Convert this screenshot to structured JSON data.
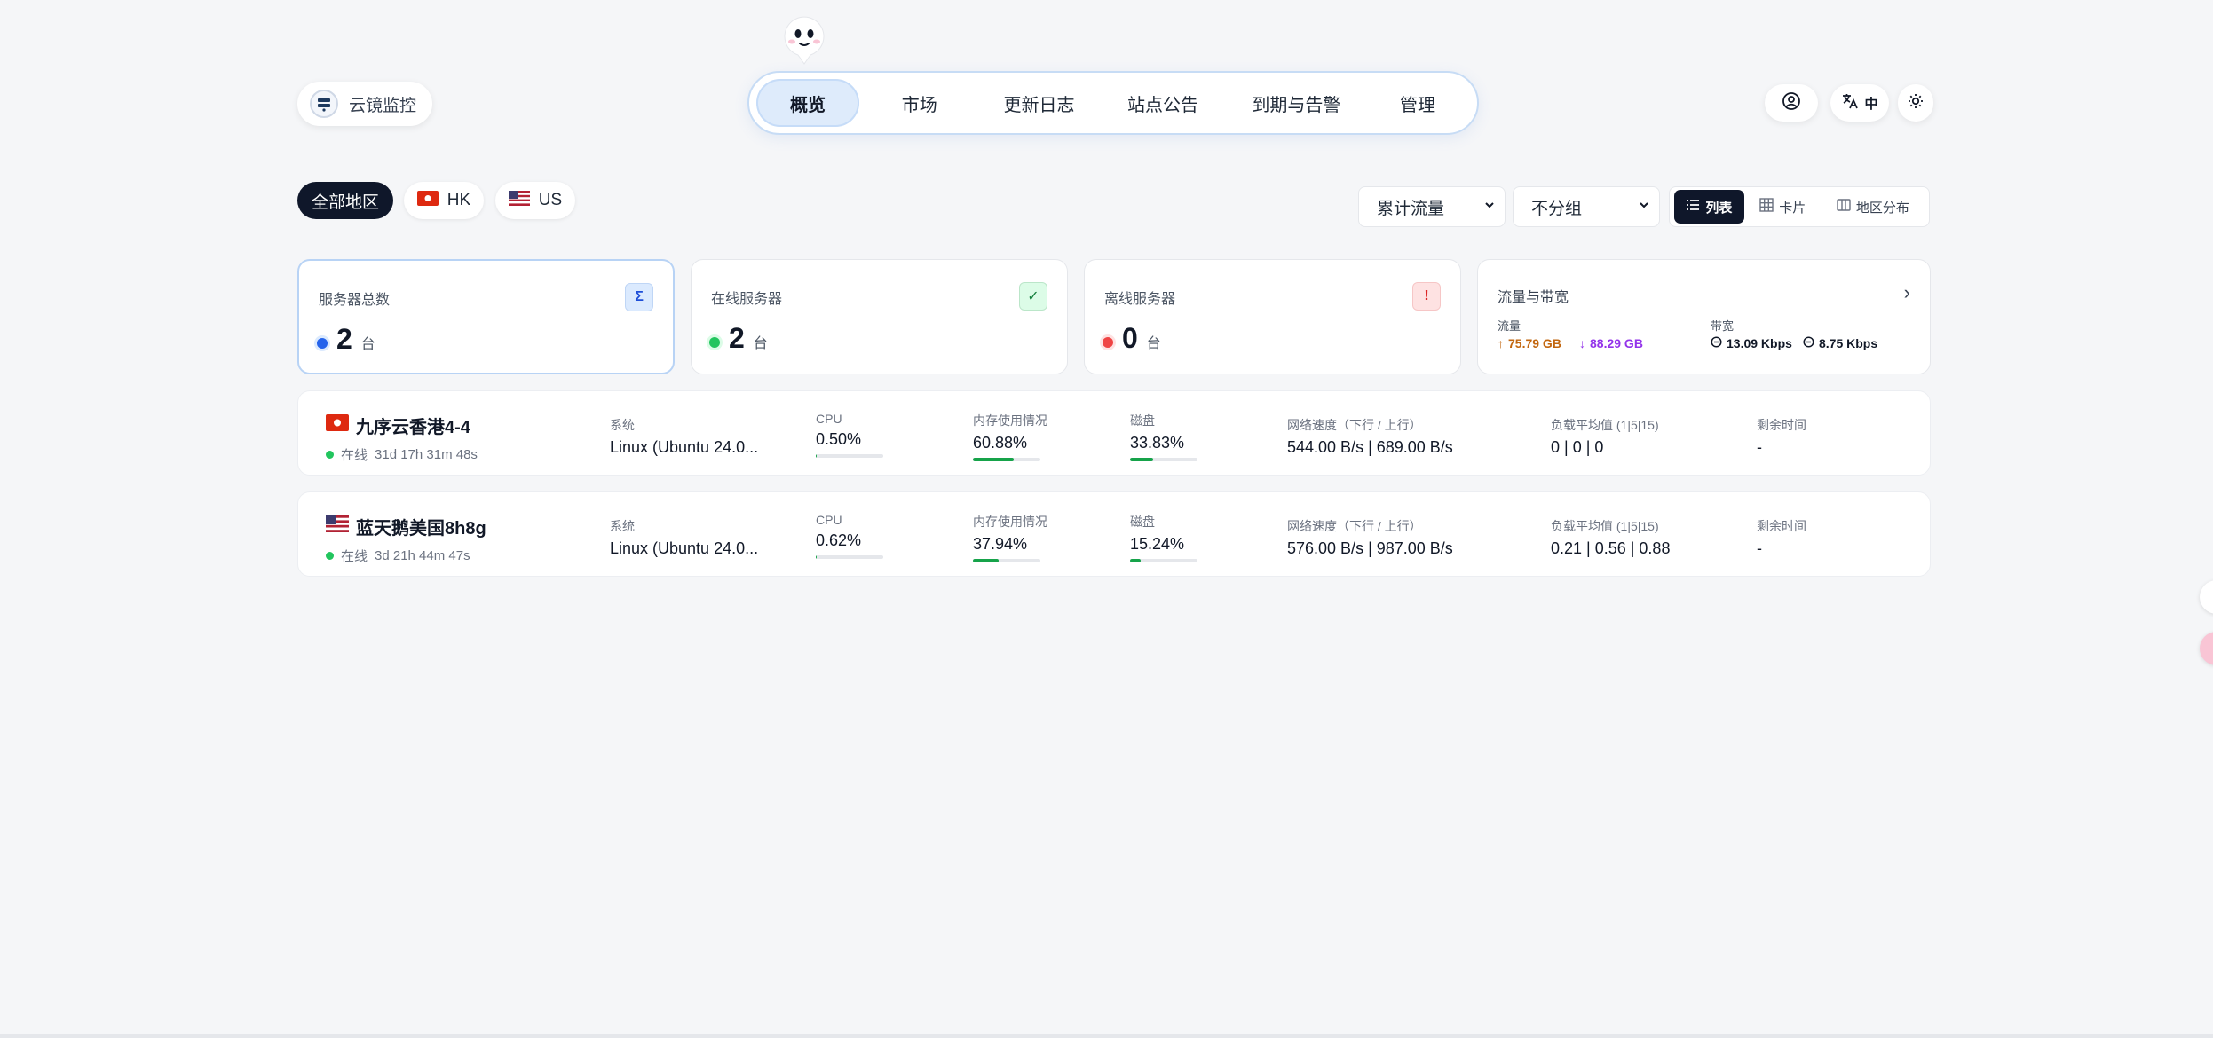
{
  "header": {
    "brand_name": "云镜监控",
    "nav": [
      "概览",
      "市场",
      "更新日志",
      "站点公告",
      "到期与告警",
      "管理"
    ],
    "lang_label": "中"
  },
  "filters": {
    "regions": [
      "全部地区",
      "HK",
      "US"
    ],
    "traffic_select": "累计流量",
    "group_select": "不分组",
    "views": [
      "列表",
      "卡片",
      "地区分布"
    ]
  },
  "stats": {
    "total": {
      "title": "服务器总数",
      "value": "2",
      "unit": "台",
      "badge": "Σ"
    },
    "online": {
      "title": "在线服务器",
      "value": "2",
      "unit": "台",
      "badge": "✓"
    },
    "offline": {
      "title": "离线服务器",
      "value": "0",
      "unit": "台",
      "badge": "!"
    },
    "traffic": {
      "title": "流量与带宽",
      "traffic_label": "流量",
      "up": "75.79 GB",
      "down": "88.29 GB",
      "bandwidth_label": "带宽",
      "bw_in": "13.09 Kbps",
      "bw_out": "8.75 Kbps"
    }
  },
  "columns": {
    "system": "系统",
    "cpu": "CPU",
    "memory": "内存使用情况",
    "disk": "磁盘",
    "network": "网络速度（下行 / 上行）",
    "load": "负载平均值 (1|5|15)",
    "remaining": "剩余时间"
  },
  "servers": [
    {
      "name": "九序云香港4-4",
      "status": "在线",
      "uptime": "31d 17h 31m 48s",
      "system": "Linux (Ubuntu 24.0...",
      "cpu": "0.50%",
      "cpu_pct": 0.5,
      "memory": "60.88%",
      "memory_pct": 60.88,
      "disk": "33.83%",
      "disk_pct": 33.83,
      "network": "544.00 B/s | 689.00 B/s",
      "load": "0 | 0 | 0",
      "remaining": "-"
    },
    {
      "name": "蓝天鹅美国8h8g",
      "status": "在线",
      "uptime": "3d 21h 44m 47s",
      "system": "Linux (Ubuntu 24.0...",
      "cpu": "0.62%",
      "cpu_pct": 0.62,
      "memory": "37.94%",
      "memory_pct": 37.94,
      "disk": "15.24%",
      "disk_pct": 15.24,
      "network": "576.00 B/s | 987.00 B/s",
      "load": "0.21 | 0.56 | 0.88",
      "remaining": "-"
    }
  ],
  "colors": {
    "accent": "#0f172a",
    "online": "#22c55e",
    "offline": "#ef4444",
    "total": "#2563eb",
    "bar": "#16a34a",
    "upload": "#c2660e",
    "download": "#9333ea"
  }
}
